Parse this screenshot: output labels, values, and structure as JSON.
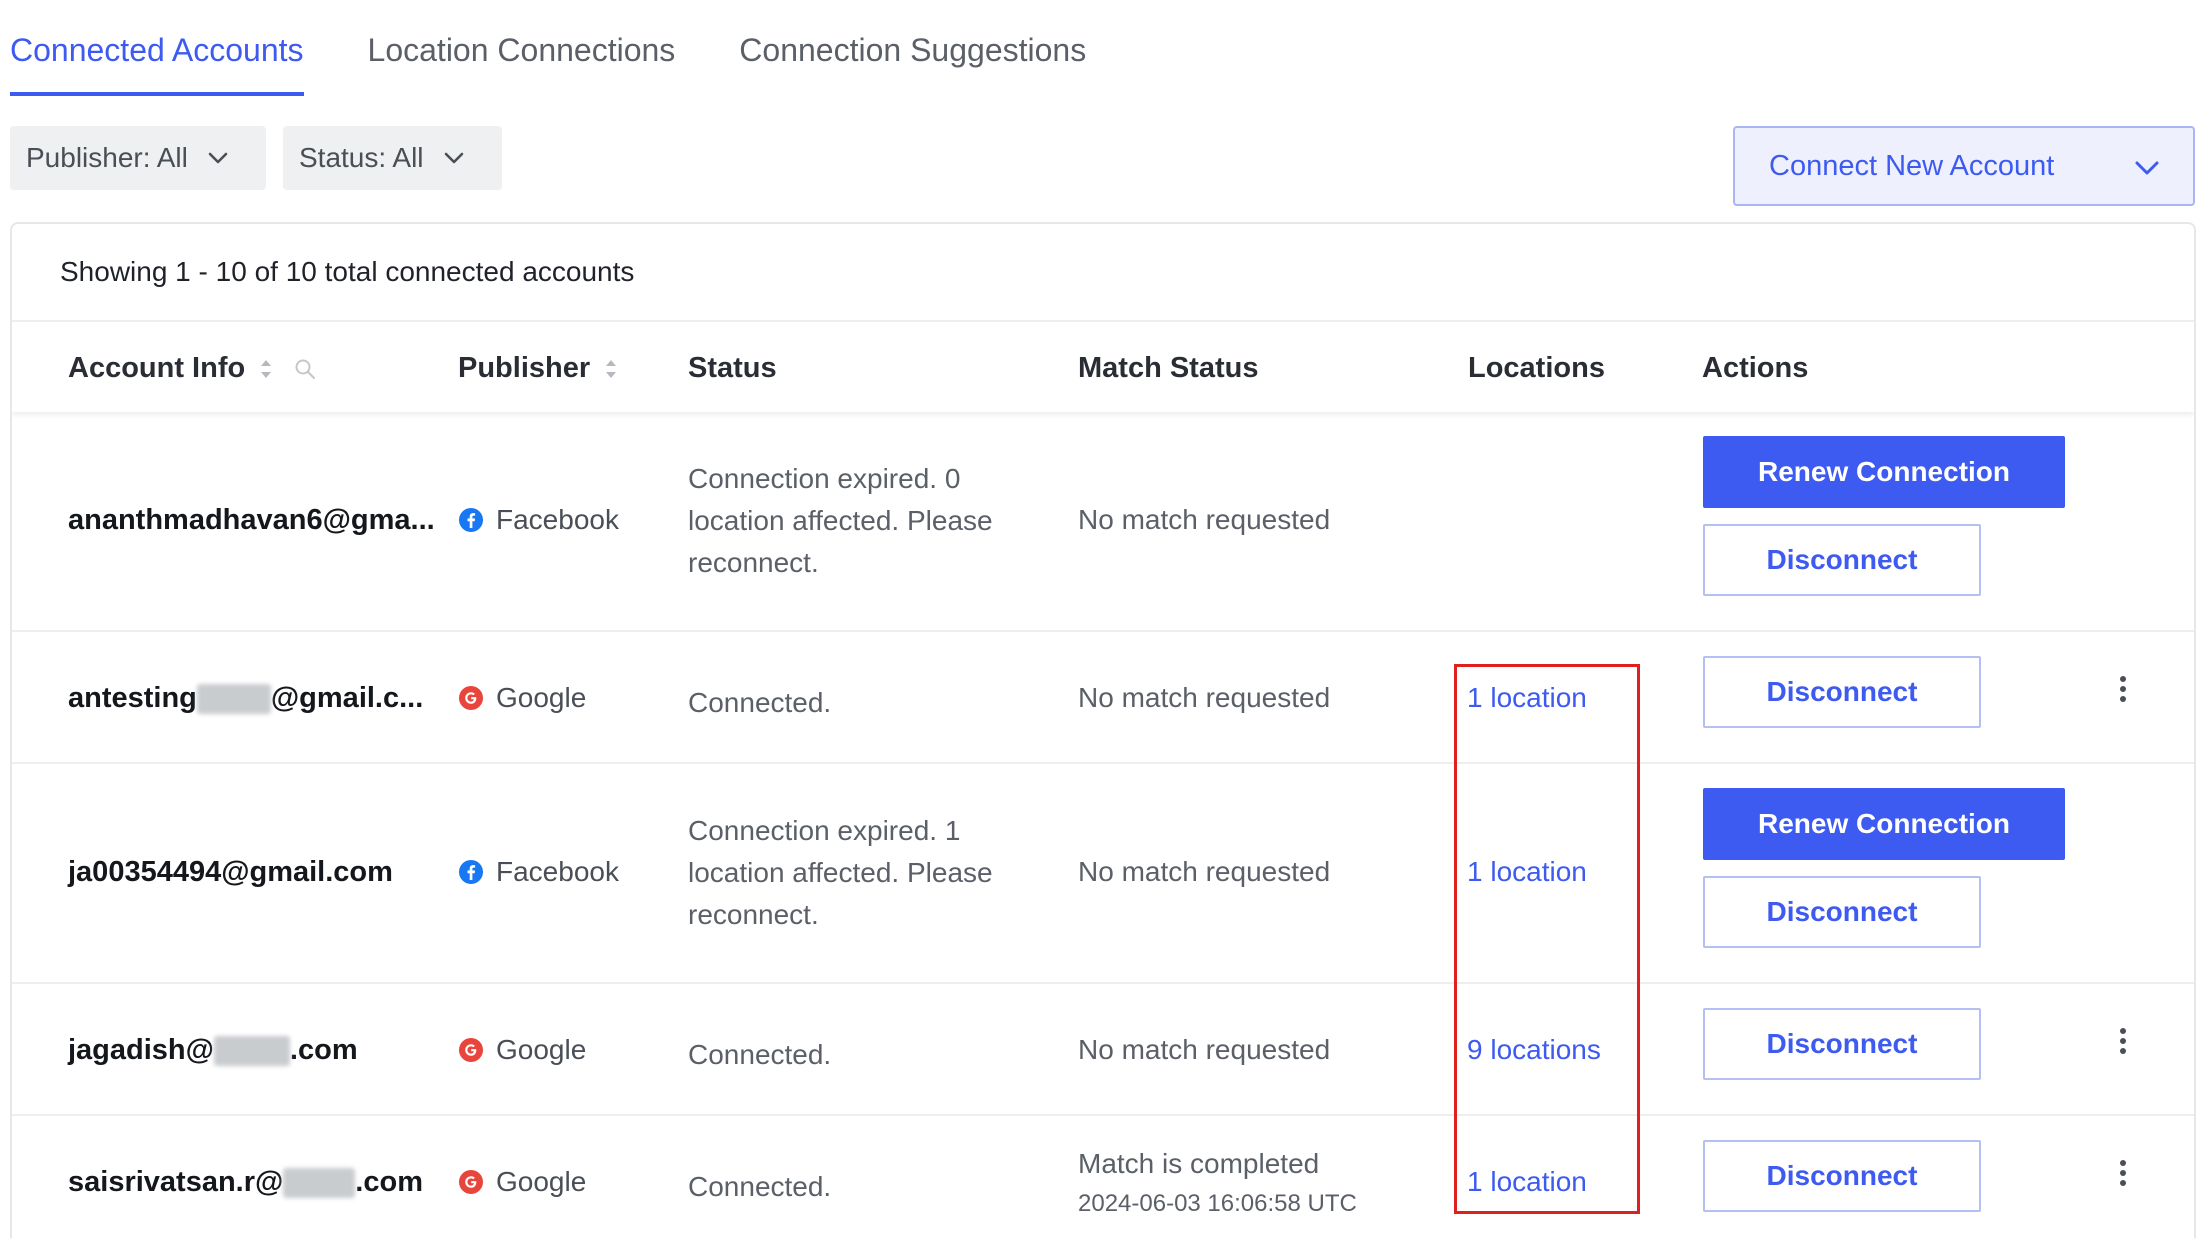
{
  "tabs": [
    {
      "label": "Connected Accounts",
      "active": true
    },
    {
      "label": "Location Connections",
      "active": false
    },
    {
      "label": "Connection Suggestions",
      "active": false
    }
  ],
  "filters": {
    "publisher": "Publisher: All",
    "status": "Status: All"
  },
  "connect_button": "Connect New Account",
  "summary": "Showing 1 - 10 of 10 total connected accounts",
  "columns": {
    "account_info": "Account Info",
    "publisher": "Publisher",
    "status": "Status",
    "match_status": "Match Status",
    "locations": "Locations",
    "actions": "Actions"
  },
  "actions": {
    "renew": "Renew Connection",
    "disconnect": "Disconnect"
  },
  "rows": [
    {
      "account_pre": "ananthmadhavan6@gma...",
      "account_post": "",
      "publisher": "Facebook",
      "status": "Connection expired. 0 location affected. Please reconnect.",
      "match": "No match requested",
      "match_date": "",
      "locations": ""
    },
    {
      "account_pre": "antesting",
      "account_post": "@gmail.c...",
      "publisher": "Google",
      "status": "Connected.",
      "match": "No match requested",
      "match_date": "",
      "locations": "1 location"
    },
    {
      "account_pre": "ja00354494@gmail.com",
      "account_post": "",
      "publisher": "Facebook",
      "status": "Connection expired. 1 location affected. Please reconnect.",
      "match": "No match requested",
      "match_date": "",
      "locations": "1 location"
    },
    {
      "account_pre": "jagadish@",
      "account_post": ".com",
      "publisher": "Google",
      "status": "Connected.",
      "match": "No match requested",
      "match_date": "",
      "locations": "9 locations"
    },
    {
      "account_pre": "saisrivatsan.r@",
      "account_post": ".com",
      "publisher": "Google",
      "status": "Connected.",
      "match": "Match is completed",
      "match_date": "2024-06-03 16:06:58 UTC",
      "locations": "1 location"
    }
  ],
  "colors": {
    "accent": "#3d5af1",
    "facebook": "#1877f2",
    "google": "#e8453c",
    "highlight": "#e0201c"
  }
}
